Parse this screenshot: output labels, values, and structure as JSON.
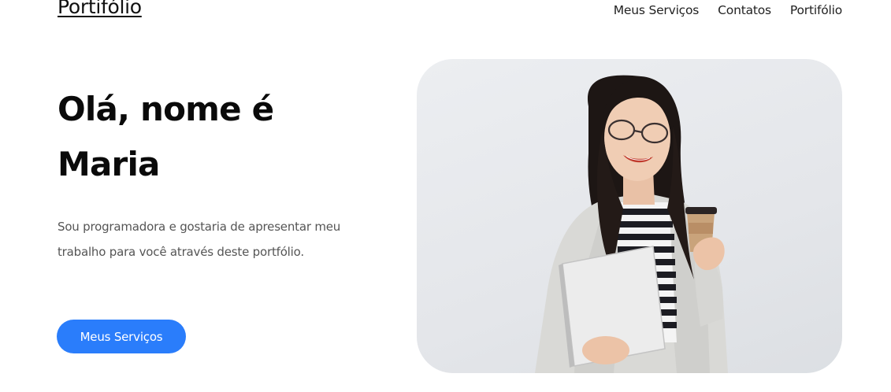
{
  "nav": {
    "logo": "Portifólio",
    "links": [
      {
        "label": "Meus Serviços"
      },
      {
        "label": "Contatos"
      },
      {
        "label": "Portifólio"
      }
    ]
  },
  "hero": {
    "title_line1": "Olá, nome é",
    "title_line2": "Maria",
    "description_line1": "Sou programadora e gostaria de apresentar meu",
    "description_line2": "trabalho para você através deste portfólio.",
    "cta_label": "Meus Serviços"
  },
  "photo": {
    "subject": "woman-with-glasses-holding-laptop-and-coffee",
    "background_color": "#e6e8eb"
  },
  "colors": {
    "accent": "#2a7dfb",
    "text_dark": "#0a0a0a",
    "text_muted": "#555555",
    "background": "#ffffff"
  }
}
